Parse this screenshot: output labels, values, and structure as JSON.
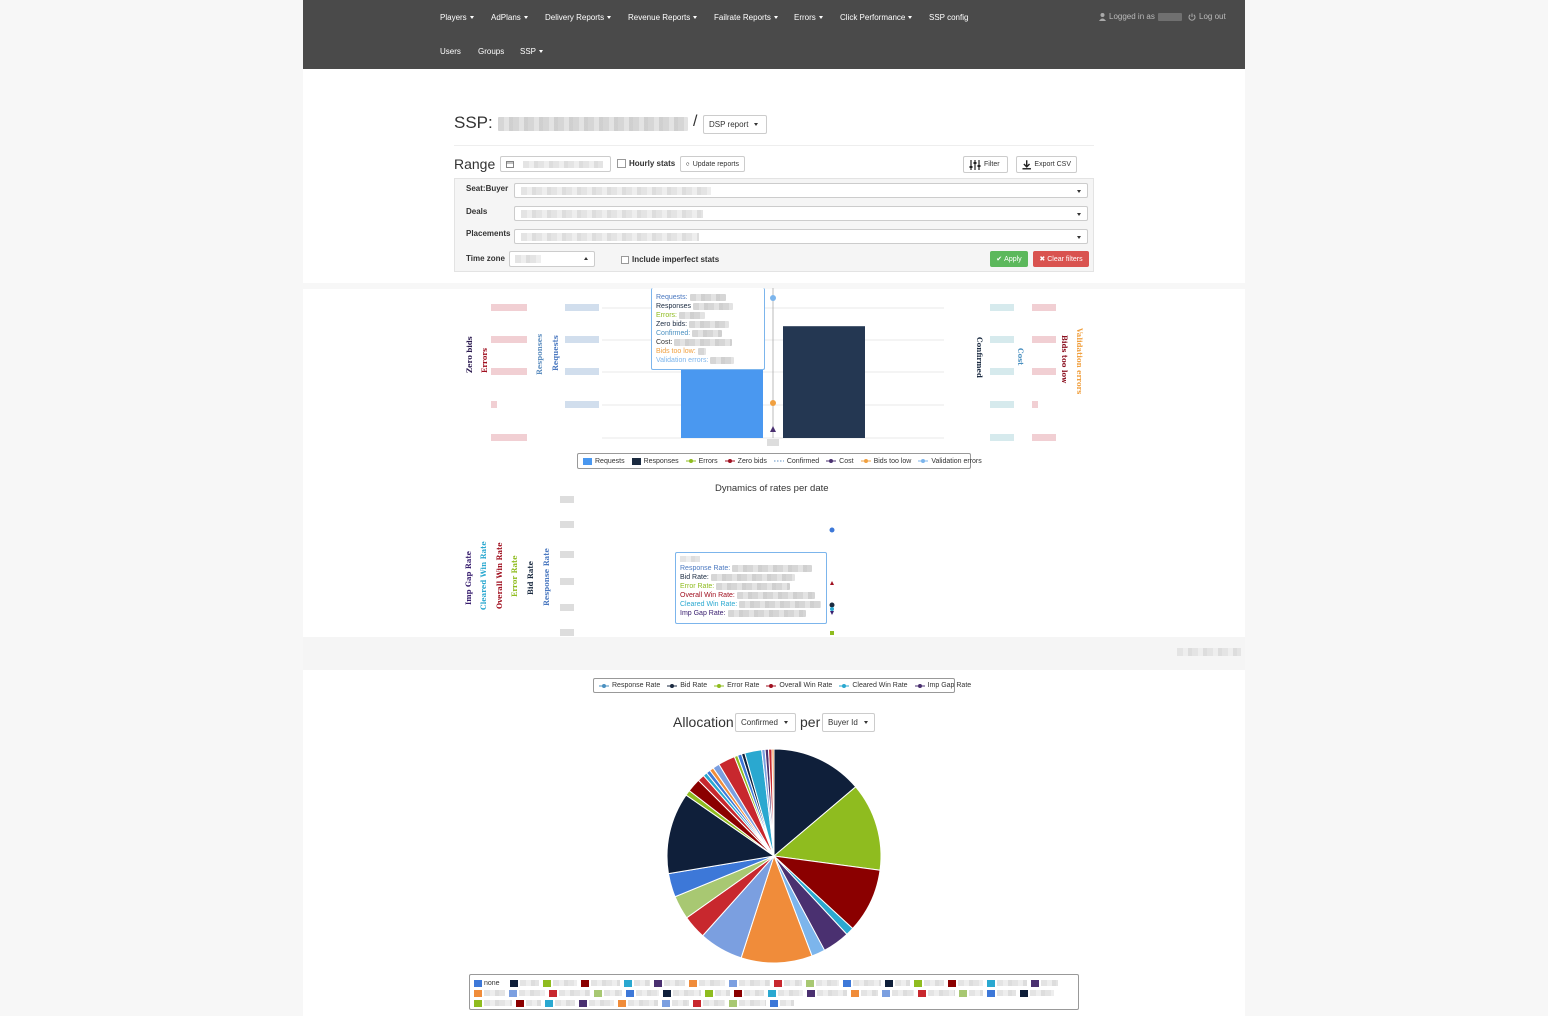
{
  "navbar": {
    "row1": [
      "Players",
      "AdPlans",
      "Delivery Reports",
      "Revenue Reports",
      "Failrate Reports",
      "Errors",
      "Click Performance",
      "SSP config"
    ],
    "row1_has_caret": [
      true,
      true,
      true,
      true,
      true,
      true,
      true,
      false
    ],
    "row2": [
      "Users",
      "Groups",
      "SSP"
    ],
    "row2_has_caret": [
      false,
      false,
      true
    ],
    "logged_in_label": "Logged in as",
    "logout_label": "Log out"
  },
  "page": {
    "title_prefix": "SSP:",
    "title_separator": "/",
    "report_dropdown": "DSP report"
  },
  "range": {
    "label": "Range",
    "hourly_stats_label": "Hourly stats",
    "update_reports_label": "Update reports",
    "filter_label": "Filter",
    "export_csv_label": "Export CSV"
  },
  "filters": {
    "seat_buyer_label": "Seat:Buyer",
    "deals_label": "Deals",
    "placements_label": "Placements",
    "time_zone_label": "Time zone",
    "include_imperfect_label": "Include imperfect stats",
    "apply_label": "Apply",
    "clear_filters_label": "Clear filters"
  },
  "chart1": {
    "left_axis_titles": [
      {
        "text": "Zero bids",
        "color": "#2b1a50"
      },
      {
        "text": "Errors",
        "color": "#a01020"
      },
      {
        "text": "Responses",
        "color": "#5f8fc0"
      },
      {
        "text": "Requests",
        "color": "#4a78c0"
      }
    ],
    "right_axis_titles": [
      {
        "text": "Confirmed",
        "color": "#1a2a40"
      },
      {
        "text": "Cost",
        "color": "#4a90c0"
      },
      {
        "text": "Bids too low",
        "color": "#8b1020"
      },
      {
        "text": "Validation errors",
        "color": "#f0a040"
      }
    ],
    "tooltip_rows": [
      {
        "label": "Requests:",
        "color": "#4a78c0"
      },
      {
        "label": "Responses",
        "color": "#1a2a40"
      },
      {
        "label": "Errors:",
        "color": "#8fbc1f"
      },
      {
        "label": "Zero bids:",
        "color": "#1a2a40"
      },
      {
        "label": "Confirmed:",
        "color": "#4a90c0"
      },
      {
        "label": "Cost:",
        "color": "#333333"
      },
      {
        "label": "Bids too low:",
        "color": "#f0a040"
      },
      {
        "label": "Validation errors:",
        "color": "#7cb5ec"
      }
    ],
    "legend": [
      {
        "label": "Requests",
        "color": "#4a98f0",
        "shape": "square"
      },
      {
        "label": "Responses",
        "color": "#1a2a40",
        "shape": "square"
      },
      {
        "label": "Errors",
        "color": "#8fbc1f",
        "shape": "line-dot"
      },
      {
        "label": "Zero bids",
        "color": "#a01020",
        "shape": "line-dot"
      },
      {
        "label": "Confirmed",
        "color": "#5f8fc0",
        "shape": "dotted"
      },
      {
        "label": "Cost",
        "color": "#4a3070",
        "shape": "line-dot"
      },
      {
        "label": "Bids too low",
        "color": "#f0a040",
        "shape": "line-dot"
      },
      {
        "label": "Validation errors",
        "color": "#7cb5ec",
        "shape": "line-dot"
      }
    ]
  },
  "chart2": {
    "title": "Dynamics of rates per date",
    "left_axis_titles": [
      {
        "text": "Imp Gap Rate",
        "color": "#3a2070"
      },
      {
        "text": "Cleared Win Rate",
        "color": "#2aa8d0"
      },
      {
        "text": "Overall Win Rate",
        "color": "#a01020"
      },
      {
        "text": "Error Rate",
        "color": "#8fbc1f"
      },
      {
        "text": "Bid Rate",
        "color": "#1a2a40"
      },
      {
        "text": "Response Rate",
        "color": "#4a78c0"
      }
    ],
    "tooltip_rows": [
      {
        "label": "Response Rate:",
        "color": "#4a78c0"
      },
      {
        "label": "Bid Rate:",
        "color": "#1a2a40"
      },
      {
        "label": "Error Rate:",
        "color": "#8fbc1f"
      },
      {
        "label": "Overall Win Rate:",
        "color": "#a01020"
      },
      {
        "label": "Cleared Win Rate:",
        "color": "#2aa8d0"
      },
      {
        "label": "Imp Gap Rate:",
        "color": "#3a2070"
      }
    ],
    "legend": [
      {
        "label": "Response Rate",
        "color": "#4a90c0"
      },
      {
        "label": "Bid Rate",
        "color": "#1a2a40"
      },
      {
        "label": "Error Rate",
        "color": "#8fbc1f"
      },
      {
        "label": "Overall Win Rate",
        "color": "#a01020"
      },
      {
        "label": "Cleared Win Rate",
        "color": "#2aa8d0"
      },
      {
        "label": "Imp Gap Rate",
        "color": "#4a3070"
      }
    ]
  },
  "allocation": {
    "title": "Allocation",
    "metric_dropdown": "Confirmed",
    "per_label": "per",
    "group_dropdown": "Buyer Id",
    "first_legend_label": "none"
  },
  "chart_data": [
    {
      "type": "bar",
      "categories": [
        "",
        ""
      ],
      "series": [
        {
          "name": "Requests",
          "values": [
            100,
            null
          ]
        },
        {
          "name": "Responses",
          "values": [
            null,
            86
          ]
        }
      ]
    },
    {
      "type": "pie",
      "slices": [
        {
          "value": 13.5,
          "color": "#0f1f3a"
        },
        {
          "value": 13.0,
          "color": "#8fbc1f"
        },
        {
          "value": 9.5,
          "color": "#8b0000"
        },
        {
          "value": 1.2,
          "color": "#2aa8d0"
        },
        {
          "value": 4.0,
          "color": "#4a3070"
        },
        {
          "value": 2.0,
          "color": "#7cb5ec"
        },
        {
          "value": 10.5,
          "color": "#f08c3a"
        },
        {
          "value": 6.5,
          "color": "#7b9fe0"
        },
        {
          "value": 3.5,
          "color": "#c8282e"
        },
        {
          "value": 3.5,
          "color": "#a8c872"
        },
        {
          "value": 3.5,
          "color": "#3d78d8"
        },
        {
          "value": 12.0,
          "color": "#0f1f3a"
        },
        {
          "value": 0.8,
          "color": "#8fbc1f"
        },
        {
          "value": 2.0,
          "color": "#8b0000"
        },
        {
          "value": 1.0,
          "color": "#c8282e"
        },
        {
          "value": 0.6,
          "color": "#2aa8d0"
        },
        {
          "value": 0.6,
          "color": "#3d78d8"
        },
        {
          "value": 0.6,
          "color": "#f08c3a"
        },
        {
          "value": 1.0,
          "color": "#7b9fe0"
        },
        {
          "value": 2.5,
          "color": "#c8282e"
        },
        {
          "value": 0.5,
          "color": "#8fbc1f"
        },
        {
          "value": 0.6,
          "color": "#3d78d8"
        },
        {
          "value": 0.5,
          "color": "#0f1f3a"
        },
        {
          "value": 2.5,
          "color": "#2aa8d0"
        },
        {
          "value": 0.5,
          "color": "#7b9fe0"
        },
        {
          "value": 0.5,
          "color": "#4a3070"
        },
        {
          "value": 0.5,
          "color": "#c8282e"
        },
        {
          "value": 0.3,
          "color": "#f08c3a"
        }
      ]
    }
  ],
  "pie_legend_rows": [
    [
      "#3d78d8",
      "#0f1f3a",
      "#8fbc1f",
      "#8b0000",
      "#2aa8d0",
      "#4a3070",
      "#f08c3a",
      "#7b9fe0",
      "#c8282e",
      "#a8c872",
      "#3d78d8",
      "#0f1f3a",
      "#8fbc1f",
      "#8b0000",
      "#2aa8d0",
      "#4a3070"
    ],
    [
      "#f08c3a",
      "#7b9fe0",
      "#c8282e",
      "#a8c872",
      "#3d78d8",
      "#0f1f3a",
      "#8fbc1f",
      "#8b0000",
      "#2aa8d0",
      "#4a3070",
      "#f08c3a",
      "#7b9fe0",
      "#c8282e",
      "#a8c872",
      "#3d78d8",
      "#0f1f3a"
    ],
    [
      "#8fbc1f",
      "#8b0000",
      "#2aa8d0",
      "#4a3070",
      "#f08c3a",
      "#7b9fe0",
      "#c8282e",
      "#a8c872",
      "#3d78d8"
    ]
  ]
}
